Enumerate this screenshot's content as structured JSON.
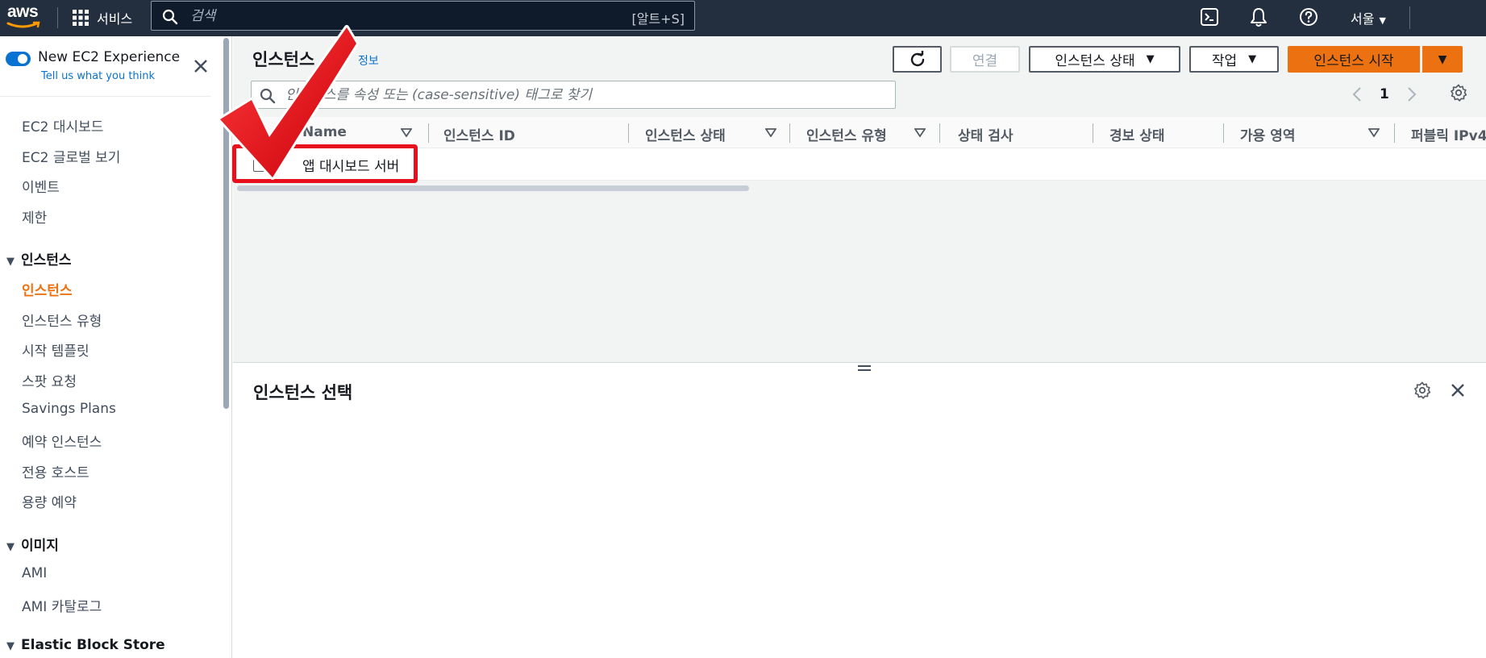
{
  "topnav": {
    "logo_text": "aws",
    "services_label": "서비스",
    "search_placeholder": "검색",
    "search_shortcut": "[알트+S]",
    "region_label": "서울"
  },
  "sidebar": {
    "experience_toggle_label": "New EC2 Experience",
    "experience_toggle_on": true,
    "feedback_link": "Tell us what you think",
    "top_items": [
      "EC2 대시보드",
      "EC2 글로벌 보기",
      "이벤트",
      "제한"
    ],
    "sections": [
      {
        "title": "인스턴스",
        "expanded": true,
        "items": [
          "인스턴스",
          "인스턴스 유형",
          "시작 템플릿",
          "스팟 요청",
          "Savings Plans",
          "예약 인스턴스",
          "전용 호스트",
          "용량 예약"
        ],
        "active_item": "인스턴스"
      },
      {
        "title": "이미지",
        "expanded": true,
        "items": [
          "AMI",
          "AMI 카탈로그"
        ]
      },
      {
        "title": "Elastic Block Store",
        "expanded": true,
        "items": []
      }
    ]
  },
  "instances_panel": {
    "title": "인스턴스",
    "info_link": "정보",
    "buttons": {
      "connect": "연결",
      "instance_state": "인스턴스 상태",
      "actions": "작업",
      "launch": "인스턴스 시작"
    },
    "filter_placeholder": "인스턴스를 속성 또는 (case-sensitive) 태그로 찾기",
    "current_page": "1",
    "columns": [
      "Name",
      "인스턴스 ID",
      "인스턴스 상태",
      "인스턴스 유형",
      "상태 검사",
      "경보 상태",
      "가용 영역",
      "퍼블릭 IPv4"
    ],
    "rows": [
      {
        "name": "앱 대시보드 서버",
        "selected": false,
        "other_cells_legible": false
      }
    ]
  },
  "details_panel": {
    "title": "인스턴스 선택"
  },
  "colors": {
    "nav_background": "#232f3e",
    "accent_orange": "#ec7211",
    "link_blue": "#0972d3",
    "annotation_red": "#e8101c"
  }
}
